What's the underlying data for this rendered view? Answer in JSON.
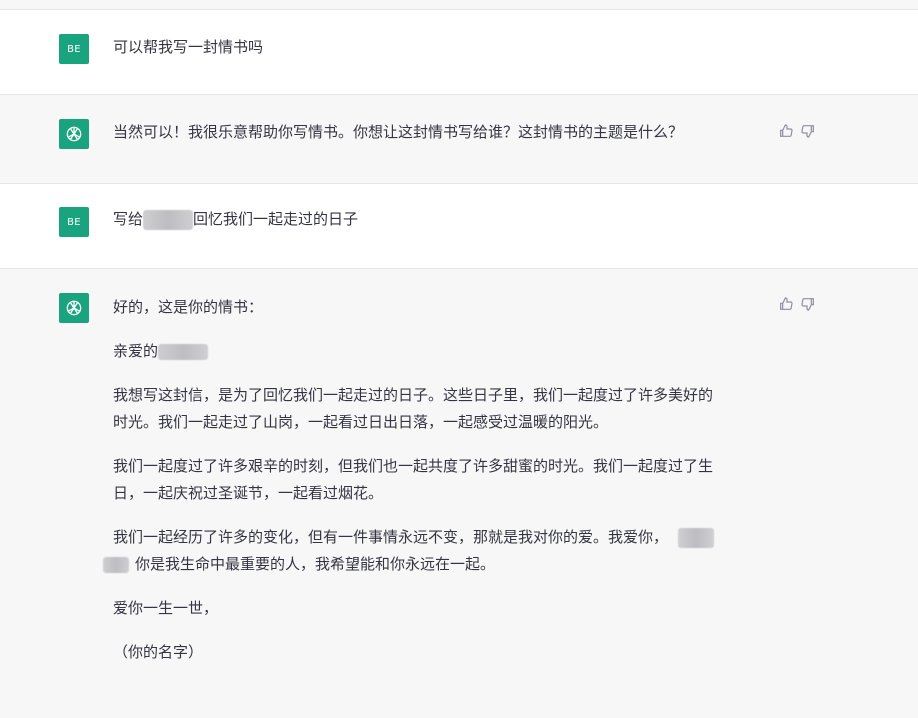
{
  "user_avatar_label": "BE",
  "conversation": {
    "m1_user": "可以帮我写一封情书吗",
    "m2_assistant": "当然可以！我很乐意帮助你写情书。你想让这封情书写给谁？这封情书的主题是什么？",
    "m3_user_pre": "写给",
    "m3_user_post": "回忆我们一起走过的日子",
    "m4": {
      "intro": "好的，这是你的情书：",
      "greeting": "亲爱的",
      "p1_line1": "我想写这封信，是为了回忆我们一起走过的日子。这些日子里，我们一起度过了许多美好的",
      "p1_line2": "时光。我们一起走过了山岗，一起看过日出日落，一起感受过温暖的阳光。",
      "p2_line1": "我们一起度过了许多艰辛的时刻，但我们也一起共度了许多甜蜜的时光。我们一起度过了生",
      "p2_line2": "日，一起庆祝过圣诞节，一起看过烟花。",
      "p3_line1": "我们一起经历了许多的变化，但有一件事情永远不变，那就是我对你的爱。我爱你，",
      "p3_line2": "你是我生命中最重要的人，我希望能和你永远在一起。",
      "closing": "爱你一生一世，",
      "signature": "（你的名字）"
    }
  },
  "colors": {
    "avatar_bg": "#19a37f",
    "assistant_bg": "#f7f7f8",
    "user_bg": "#ffffff",
    "text": "#343541"
  }
}
